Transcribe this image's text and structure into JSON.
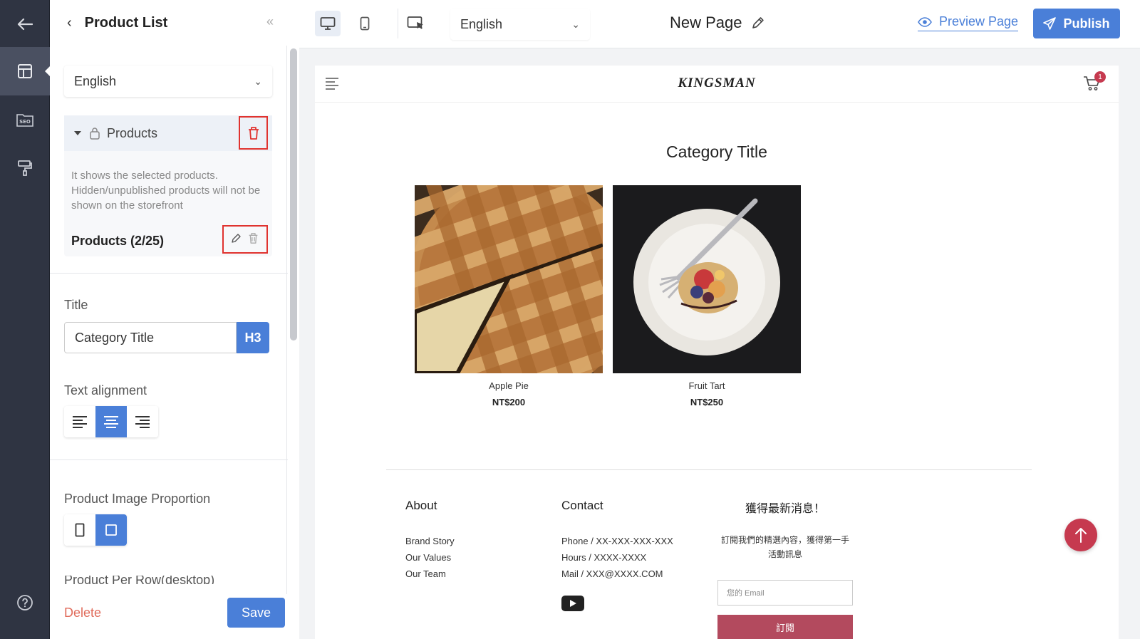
{
  "panel": {
    "title": "Product List",
    "language": "English",
    "products_block_label": "Products",
    "description": "It shows the selected products. Hidden/unpublished products will not be shown on the storefront",
    "products_count": "Products (2/25)",
    "title_label": "Title",
    "title_value": "Category Title",
    "heading_level": "H3",
    "text_alignment_label": "Text alignment",
    "text_alignment": "center",
    "image_proportion_label": "Product Image Proportion",
    "image_proportion": "square",
    "cutoff_label": "Product Per Row(desktop)",
    "delete_label": "Delete",
    "save_label": "Save"
  },
  "toolbar": {
    "language": "English",
    "page_name": "New Page",
    "preview_label": "Preview Page",
    "publish_label": "Publish",
    "device": "desktop"
  },
  "store": {
    "brand": "KINGSMAN",
    "cart_count": "1",
    "category_title": "Category Title",
    "products": [
      {
        "name": "Apple Pie",
        "price": "NT$200"
      },
      {
        "name": "Fruit Tart",
        "price": "NT$250"
      }
    ],
    "footer": {
      "about": {
        "heading": "About",
        "links": [
          "Brand Story",
          "Our Values",
          "Our Team"
        ]
      },
      "contact": {
        "heading": "Contact",
        "lines": [
          "Phone / XX-XXX-XXX-XXX",
          "Hours / XXXX-XXXX",
          "Mail / XXX@XXXX.COM"
        ]
      },
      "newsletter": {
        "heading": "獲得最新消息！",
        "text": "訂閱我們的精選內容，獲得第一手活動訊息",
        "email_placeholder": "您的 Email",
        "button_label": "訂閱"
      }
    }
  },
  "colors": {
    "accent": "#4a7fd8",
    "rail": "#2f3442",
    "store_accent": "#c63a4f",
    "highlight": "#e0332f"
  }
}
